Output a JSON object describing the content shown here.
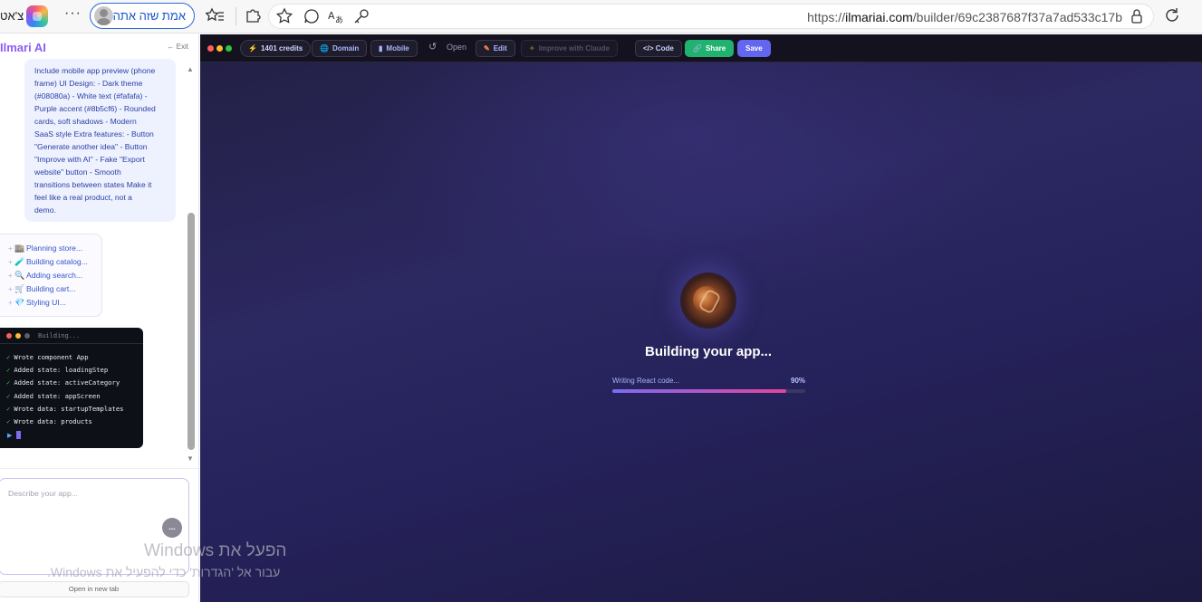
{
  "browser": {
    "lang_label": "צ'אט",
    "more_label": "···",
    "profile_name": "אמת שזה אתה",
    "url_prefix": "https://",
    "url_host": "ilmariai.com",
    "url_path": "/builder/69c2387687f37a7ad533c17b"
  },
  "sidebar": {
    "brand": "Ilmari AI",
    "exit_label": "← Exit",
    "prompt_lines": [
      "Include mobile app preview (phone",
      "frame) UI Design: - Dark theme",
      "(#08080a) - White text (#fafafa) -",
      "Purple accent (#8b5cf6) - Rounded",
      "cards, soft shadows - Modern",
      "SaaS style Extra features: - Button",
      "\"Generate another idea\" - Button",
      "\"Improve with AI\" - Fake \"Export",
      "website\" button - Smooth",
      "transitions between states Make it",
      "feel like a real product, not a",
      "demo."
    ],
    "steps": [
      {
        "icon": "🏬",
        "label": "Planning store..."
      },
      {
        "icon": "🧪",
        "label": "Building catalog..."
      },
      {
        "icon": "🔍",
        "label": "Adding search..."
      },
      {
        "icon": "🛒",
        "label": "Building cart..."
      },
      {
        "icon": "💎",
        "label": "Styling UI..."
      }
    ],
    "terminal": {
      "title": "Building...",
      "lines": [
        "Wrote component App",
        "Added state: loadingStep",
        "Added state: activeCategory",
        "Added state: appScreen",
        "Wrote data: startupTemplates",
        "Wrote data: products"
      ]
    },
    "composer_placeholder": "Describe your app...",
    "send_label": "...",
    "open_new_tab": "Open in new tab"
  },
  "toolbar": {
    "credits": "1401 credits",
    "domain": "Domain",
    "mobile": "Mobile",
    "open": "Open",
    "edit": "Edit",
    "improve": "Improve with Claude",
    "code": "</> Code",
    "share": "Share",
    "save": "Save"
  },
  "preview": {
    "title": "Building your app...",
    "progress_label": "Writing React code...",
    "progress_text": "90%",
    "progress_value": 0.9
  },
  "watermark": {
    "line1": "הפעל את Windows",
    "line2": "עבור אל 'הגדרות' כדי להפעיל את Windows."
  },
  "colors": {
    "accent": "#8b5cf6",
    "share": "#1fb36f",
    "save": "#6366f1",
    "progress_start": "#7c6cf0",
    "progress_end": "#e3459a"
  }
}
